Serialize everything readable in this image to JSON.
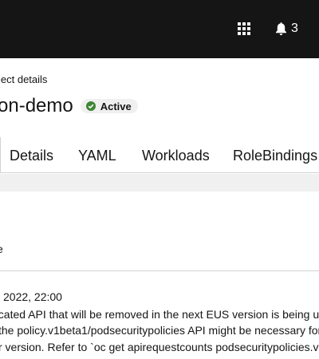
{
  "masthead": {
    "apps_icon": "grid-apps-icon",
    "bell_icon": "bell-icon",
    "notification_count": "3",
    "background": "#151515"
  },
  "breadcrumb": "ject details",
  "header": {
    "title": "on-demo",
    "status": "Active",
    "status_color": "#3e8635"
  },
  "tabs": [
    {
      "label": "Details"
    },
    {
      "label": "YAML"
    },
    {
      "label": "Workloads"
    },
    {
      "label": "RoleBindings"
    }
  ],
  "body_text": "e",
  "alert": {
    "timestamp": "2022, 22:00",
    "lines": [
      "ecated API that will be removed in the next EUS version is being us",
      "the policy.v1beta1/podsecuritypolicies API might be necessary for",
      "r version. Refer to `oc get apirequestcounts podsecuritypolicies.v"
    ]
  }
}
